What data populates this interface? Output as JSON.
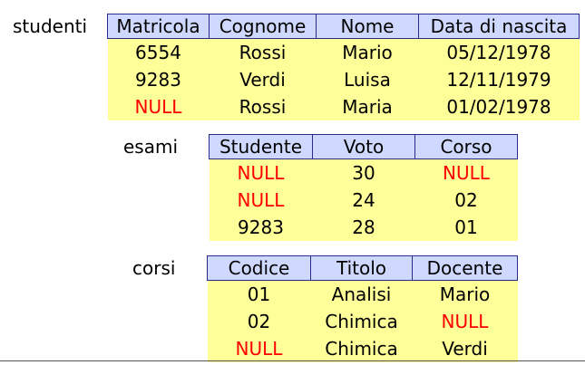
{
  "colors": {
    "header_fill": "#cfd9ff",
    "header_border": "#2b2b8f",
    "body_fill": "#ffff99",
    "null_text": "#ff0000"
  },
  "tables": {
    "studenti": {
      "label": "studenti",
      "columns": [
        "Matricola",
        "Cognome",
        "Nome",
        "Data di nascita"
      ],
      "rows": [
        [
          "6554",
          "Rossi",
          "Mario",
          "05/12/1978"
        ],
        [
          "9283",
          "Verdi",
          "Luisa",
          "12/11/1979"
        ],
        [
          "NULL",
          "Rossi",
          "Maria",
          "01/02/1978"
        ]
      ]
    },
    "esami": {
      "label": "esami",
      "columns": [
        "Studente",
        "Voto",
        "Corso"
      ],
      "rows": [
        [
          "NULL",
          "30",
          "NULL"
        ],
        [
          "NULL",
          "24",
          "02"
        ],
        [
          "9283",
          "28",
          "01"
        ]
      ]
    },
    "corsi": {
      "label": "corsi",
      "columns": [
        "Codice",
        "Titolo",
        "Docente"
      ],
      "rows": [
        [
          "01",
          "Analisi",
          "Mario"
        ],
        [
          "02",
          "Chimica",
          "NULL"
        ],
        [
          "NULL",
          "Chimica",
          "Verdi"
        ]
      ]
    }
  }
}
